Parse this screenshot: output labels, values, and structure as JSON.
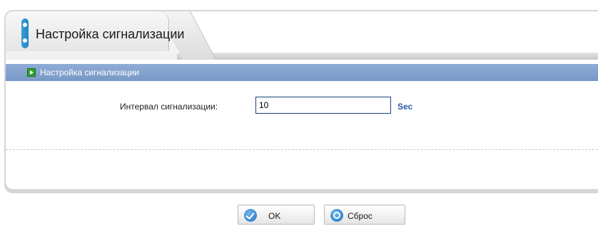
{
  "tab": {
    "title": "Настройка сигнализации",
    "icon": "panel-tab-icon"
  },
  "section": {
    "title": "Настройка сигнализации",
    "icon": "green-arrow-icon"
  },
  "form": {
    "alarm_interval": {
      "label": "Интервал сигнализации:",
      "value": "10",
      "unit": "Sec"
    }
  },
  "buttons": {
    "ok_label": "OK",
    "reset_label": "Сброс"
  },
  "colors": {
    "section_bar": "#7f9ccb",
    "unit_text": "#2a57a8",
    "input_border": "#1a3f80",
    "button_icon": "#1f73c2",
    "section_icon": "#2f9f2f"
  }
}
